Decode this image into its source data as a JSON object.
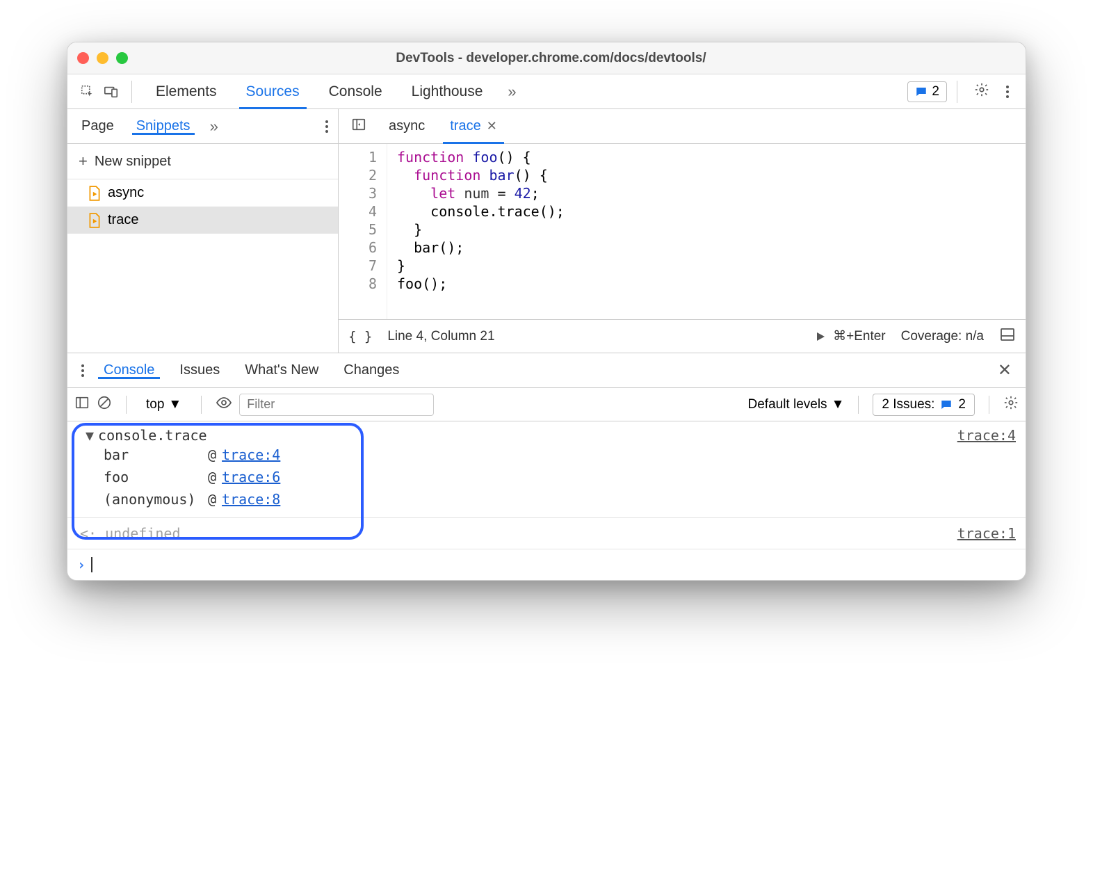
{
  "window": {
    "title": "DevTools - developer.chrome.com/docs/devtools/"
  },
  "mainTabs": {
    "elements": "Elements",
    "sources": "Sources",
    "console": "Console",
    "lighthouse": "Lighthouse"
  },
  "headerIssues": {
    "count": "2"
  },
  "leftTabs": {
    "page": "Page",
    "snippets": "Snippets"
  },
  "newSnippet": "New snippet",
  "files": {
    "f0": "async",
    "f1": "trace"
  },
  "editorTabs": {
    "t0": "async",
    "t1": "trace"
  },
  "code": {
    "lines": [
      "1",
      "2",
      "3",
      "4",
      "5",
      "6",
      "7",
      "8"
    ],
    "l1_kw": "function",
    "l1_fn": "foo",
    "l1_rest": "() {",
    "l2_kw": "function",
    "l2_fn": "bar",
    "l2_rest": "() {",
    "l3_kw": "let",
    "l3_id": "num",
    "l3_eq": " = ",
    "l3_num": "42",
    "l3_semi": ";",
    "l4": "console.trace();",
    "l5": "}",
    "l6": "bar();",
    "l7": "}",
    "l8": "foo();"
  },
  "status": {
    "pretty": "{ }",
    "pos": "Line 4, Column 21",
    "run": "⌘+Enter",
    "coverage": "Coverage: n/a"
  },
  "drawerTabs": {
    "console": "Console",
    "issues": "Issues",
    "whatsnew": "What's New",
    "changes": "Changes"
  },
  "consoleToolbar": {
    "context": "top",
    "filterPlaceholder": "Filter",
    "levels": "Default levels",
    "issuesLabel": "2 Issues:",
    "issuesCount": "2"
  },
  "trace": {
    "title": "console.trace",
    "source": "trace:4",
    "stack": [
      {
        "fn": "bar",
        "at": "@",
        "link": "trace:4"
      },
      {
        "fn": "foo",
        "at": "@",
        "link": "trace:6"
      },
      {
        "fn": "(anonymous)",
        "at": "@",
        "link": "trace:8"
      }
    ]
  },
  "undefRow": {
    "value": "undefined",
    "source": "trace:1"
  }
}
